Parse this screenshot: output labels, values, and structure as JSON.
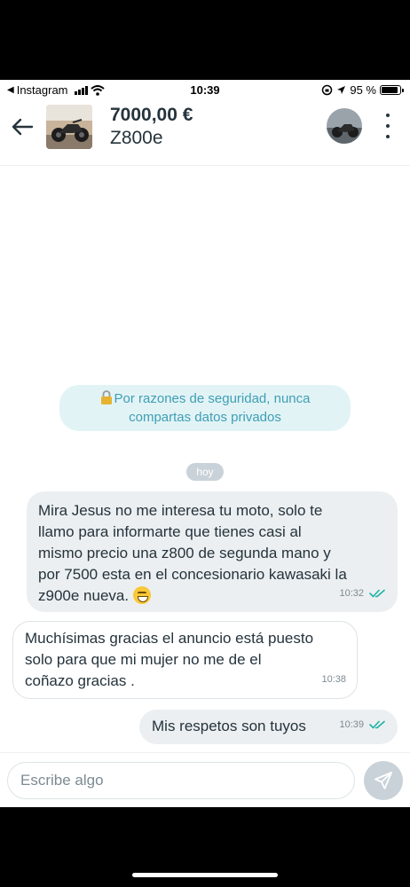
{
  "status_bar": {
    "back_app": "Instagram",
    "time": "10:39",
    "battery_text": "95 %",
    "battery_level": 0.95
  },
  "header": {
    "price": "7000,00 €",
    "title": "Z800e"
  },
  "conversation": {
    "security_notice_line1": "Por razones de seguridad, nunca",
    "security_notice_line2": "compartas datos privados",
    "date_label": "hoy",
    "messages": [
      {
        "lines": [
          "Mira Jesus no me interesa tu moto, solo te",
          "llamo para informarte que tienes casi al",
          "mismo precio una z800 de segunda mano y",
          "por 7500 esta en el concesionario kawasaki la",
          "z900e nueva. "
        ],
        "emoji": "smiling-face-with-sweat-emoji",
        "time": "10:32",
        "status": "read"
      },
      {
        "lines": [
          "Muchísimas gracias el anuncio está puesto",
          "solo para que mi mujer no me de el",
          "coñazo gracias ."
        ],
        "time": "10:38"
      },
      {
        "lines": [
          "Mis respetos son tuyos"
        ],
        "time": "10:39",
        "status": "read"
      }
    ]
  },
  "composer": {
    "placeholder": "Escribe algo"
  },
  "colors": {
    "primary_text": "#25333c",
    "notice_text": "#3e9fb4",
    "notice_bg": "#e2f3f6",
    "read_check": "#1fb2a6",
    "bubble_own": "#eceff1"
  }
}
